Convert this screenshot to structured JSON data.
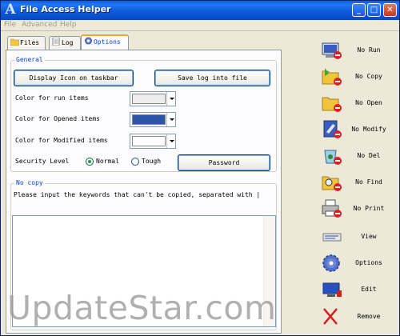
{
  "window": {
    "title": "File Access Helper"
  },
  "menu": [
    "File",
    "Advanced",
    "Help"
  ],
  "tabs": [
    {
      "label": "Files",
      "icon": "folder-icon"
    },
    {
      "label": "Log",
      "icon": "log-icon"
    },
    {
      "label": "Options",
      "icon": "gear-icon",
      "active": true
    }
  ],
  "general": {
    "label": "General",
    "display_icon_button": "Display Icon on taskbar",
    "save_log_button": "Save log into file",
    "color_run_label": "Color for run items",
    "color_opened_label": "Color for Opened items",
    "color_modified_label": "Color for Modified items",
    "color_run": "#ededed",
    "color_opened": "#2b55a6",
    "color_modified": "#ffffff",
    "security_label": "Security Level",
    "radio_normal": "Normal",
    "radio_tough": "Tough",
    "selected_level": "Normal",
    "password_button": "Password"
  },
  "nocopy": {
    "label": "No copy",
    "instruction": "Please input the keywords that can't be copied, separated with |",
    "keywords": ""
  },
  "toolbar": [
    {
      "label": "No Run",
      "icon": "monitor-no-run-icon"
    },
    {
      "label": "No Copy",
      "icon": "folder-no-copy-icon"
    },
    {
      "label": "No Open",
      "icon": "folder-no-open-icon"
    },
    {
      "label": "No Modify",
      "icon": "document-no-modify-icon"
    },
    {
      "label": "No Del",
      "icon": "recycle-bin-no-delete-icon"
    },
    {
      "label": "No Find",
      "icon": "folder-search-no-find-icon"
    },
    {
      "label": "No Print",
      "icon": "printer-no-print-icon"
    },
    {
      "label": "View",
      "icon": "view-icon"
    },
    {
      "label": "Options",
      "icon": "gear-icon"
    },
    {
      "label": "Edit",
      "icon": "monitor-edit-icon"
    },
    {
      "label": "Remove",
      "icon": "red-x-remove-icon"
    }
  ],
  "watermark": "UpdateStar.com"
}
